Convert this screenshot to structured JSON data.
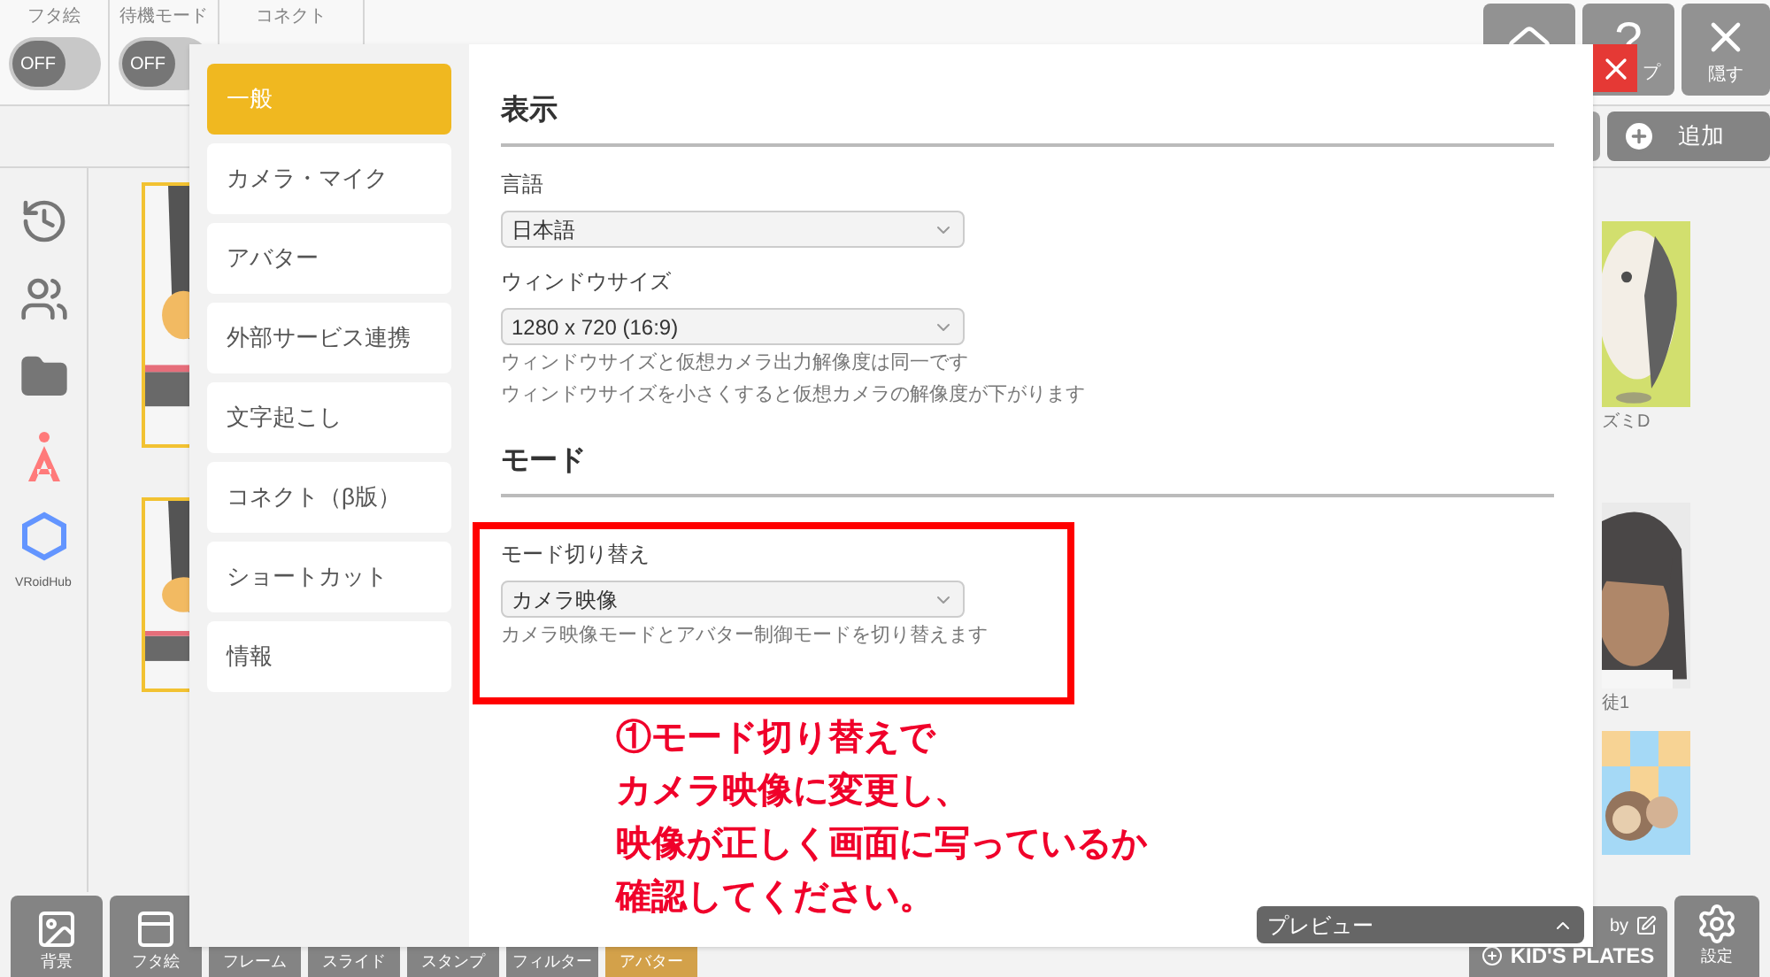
{
  "top_bar": {
    "toggles": [
      {
        "label": "フタ絵",
        "state": "OFF",
        "on": false
      },
      {
        "label": "待機モード",
        "state": "OFF",
        "on": false
      }
    ],
    "connect": "コネクト",
    "buttons": [
      {
        "kind": "home"
      },
      {
        "kind": "help",
        "symbol": "?",
        "label": "プ"
      },
      {
        "kind": "hide",
        "label": "隠す"
      }
    ]
  },
  "add_button": "追加",
  "sidebar": {
    "items": [
      {
        "kind": "history"
      },
      {
        "kind": "users"
      },
      {
        "kind": "folder"
      },
      {
        "kind": "a_logo"
      },
      {
        "kind": "hexagon"
      }
    ],
    "hub_label": "VRoidHub"
  },
  "avatar_labels": [
    "ズミD",
    "徒1"
  ],
  "toolbar": {
    "tools": [
      {
        "label": "背景",
        "selected": false
      },
      {
        "label": "フタ絵",
        "selected": false
      },
      {
        "label": "フレーム",
        "selected": false
      },
      {
        "label": "スライド",
        "selected": false
      },
      {
        "label": "スタンプ",
        "selected": false
      },
      {
        "label": "フィルター",
        "selected": false
      },
      {
        "label": "アバター",
        "selected": true
      }
    ],
    "by": "by",
    "brand": "KID'S PLATES",
    "settings": "設定"
  },
  "preview_bar": {
    "label": "プレビュー"
  },
  "settings_dialog": {
    "nav": [
      {
        "label": "一般",
        "selected": true
      },
      {
        "label": "カメラ・マイク",
        "selected": false
      },
      {
        "label": "アバター",
        "selected": false
      },
      {
        "label": "外部サービス連携",
        "selected": false
      },
      {
        "label": "文字起こし",
        "selected": false
      },
      {
        "label": "コネクト（β版）",
        "selected": false
      },
      {
        "label": "ショートカット",
        "selected": false
      },
      {
        "label": "情報",
        "selected": false
      }
    ],
    "sections": [
      {
        "title": "表示",
        "fields": [
          {
            "label": "言語",
            "value": "日本語"
          },
          {
            "label": "ウィンドウサイズ",
            "value": "1280 x 720 (16:9)",
            "notes": [
              "ウィンドウサイズと仮想カメラ出力解像度は同一です",
              "ウィンドウサイズを小さくすると仮想カメラの解像度が下がります"
            ]
          }
        ]
      },
      {
        "title": "モード",
        "fields": [
          {
            "label": "モード切り替え",
            "value": "カメラ映像",
            "highlighted": true,
            "notes": [
              "カメラ映像モードとアバター制御モードを切り替えます"
            ]
          }
        ]
      }
    ]
  },
  "annotation": {
    "lines": [
      "①モード切り替えで",
      "カメラ映像に変更し、",
      "映像が正しく画面に写っているか",
      "確認してください。"
    ]
  }
}
